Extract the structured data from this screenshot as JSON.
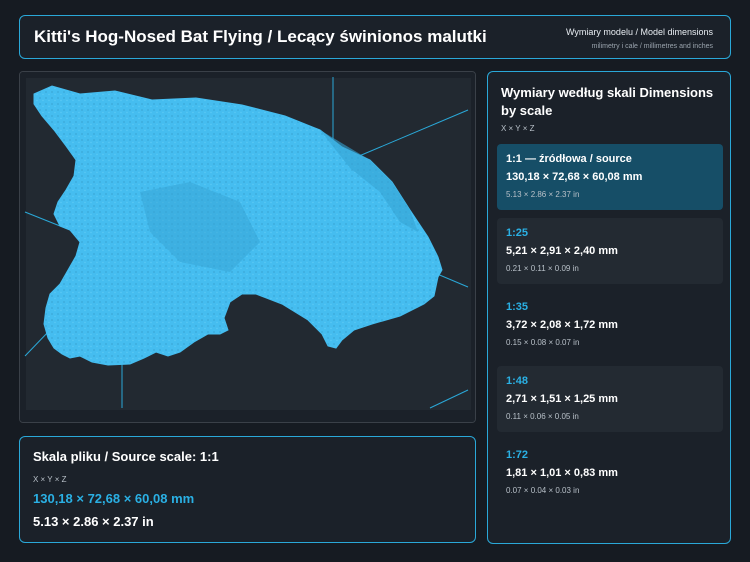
{
  "header": {
    "title": "Kitti's Hog-Nosed Bat Flying / Lecący świnionos malutki",
    "subtitle": "Wymiary modelu / Model dimensions",
    "units_note": "milimetry i cale / millimetres and inches"
  },
  "viewer": {
    "model_color": "#45bdf0",
    "guide_color": "#2aa8d8"
  },
  "source_scale": {
    "title": "Skala pliku / Source scale: 1:1",
    "axes": "X × Y × Z",
    "mm": "130,18 × 72,68 × 60,08 mm",
    "inches": "5.13 × 2.86 × 2.37 in"
  },
  "dimensions": {
    "title": "Wymiary według skali Dimensions by scale",
    "axes": "X × Y × Z",
    "scales": [
      {
        "label": "1:1  —  źródłowa / source",
        "mm": "130,18 × 72,68 × 60,08 mm",
        "inches": "5.13 × 2.86 × 2.37 in",
        "selected": true
      },
      {
        "label": "1:25",
        "mm": "5,21 × 2,91 × 2,40 mm",
        "inches": "0.21 × 0.11 × 0.09 in",
        "selected": false
      },
      {
        "label": "1:35",
        "mm": "3,72 × 2,08 × 1,72 mm",
        "inches": "0.15 × 0.08 × 0.07 in",
        "selected": false
      },
      {
        "label": "1:48",
        "mm": "2,71 × 1,51 × 1,25 mm",
        "inches": "0.11 × 0.06 × 0.05 in",
        "selected": false
      },
      {
        "label": "1:72",
        "mm": "1,81 × 1,01 × 0,83 mm",
        "inches": "0.07 × 0.04 × 0.03 in",
        "selected": false
      }
    ]
  },
  "colors": {
    "accent": "#2ab0e4",
    "selected_bg": "#164e67",
    "background": "#161b22"
  }
}
